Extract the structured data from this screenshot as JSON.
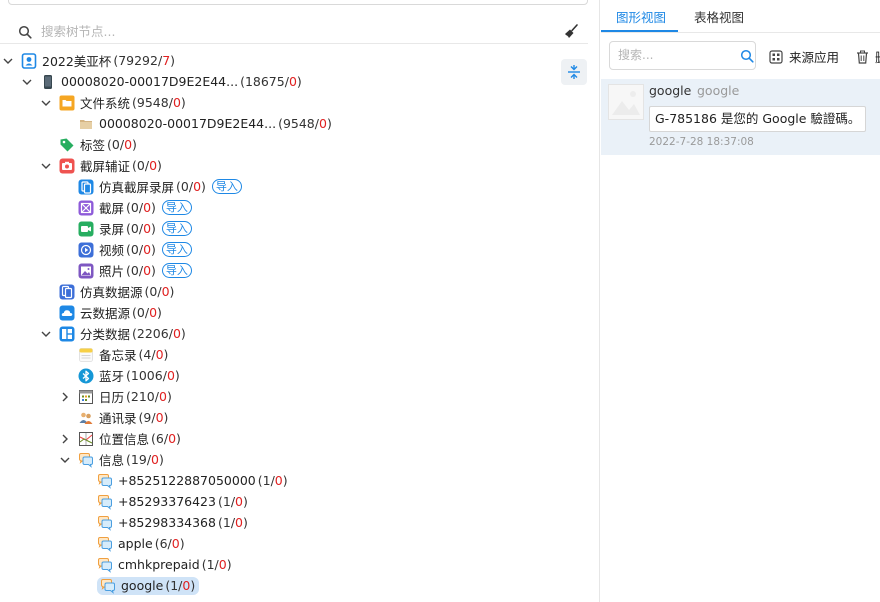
{
  "search": {
    "placeholder": "搜索树节点..."
  },
  "tree": [
    {
      "label": "2022美亚杯",
      "count": "79292",
      "red": "7",
      "level": 0,
      "chev": "down",
      "icon": "case-icon",
      "color": "#1e88e5"
    },
    {
      "label": "00008020-00017D9E2E44...",
      "count": "18675",
      "red": "0",
      "level": 1,
      "chev": "down",
      "icon": "phone-icon",
      "color": "#37474f"
    },
    {
      "label": "文件系统",
      "count": "9548",
      "red": "0",
      "level": 2,
      "chev": "down",
      "icon": "folder-icon",
      "color": "#f5a623"
    },
    {
      "label": "00008020-00017D9E2E44...",
      "count": "9548",
      "red": "0",
      "level": 3,
      "chev": "none",
      "icon": "archive-icon",
      "color": "#d4b483"
    },
    {
      "label": "标签",
      "count": "0",
      "red": "0",
      "level": 2,
      "chev": "none",
      "icon": "tag-icon",
      "color": "#27ae60"
    },
    {
      "label": "截屏辅证",
      "count": "0",
      "red": "0",
      "level": 2,
      "chev": "down",
      "icon": "camera-icon",
      "color": "#ef5350"
    },
    {
      "label": "仿真截屏录屏",
      "count": "0",
      "red": "0",
      "level": 3,
      "chev": "none",
      "icon": "emulate-icon",
      "color": "#1e88e5",
      "import": "导入"
    },
    {
      "label": "截屏",
      "count": "0",
      "red": "0",
      "level": 3,
      "chev": "none",
      "icon": "screenshot-icon",
      "color": "#8e5bd9",
      "import": "导入"
    },
    {
      "label": "录屏",
      "count": "0",
      "red": "0",
      "level": 3,
      "chev": "none",
      "icon": "record-icon",
      "color": "#27ae60",
      "import": "导入"
    },
    {
      "label": "视频",
      "count": "0",
      "red": "0",
      "level": 3,
      "chev": "none",
      "icon": "video-icon",
      "color": "#3d6fd8",
      "import": "导入"
    },
    {
      "label": "照片",
      "count": "0",
      "red": "0",
      "level": 3,
      "chev": "none",
      "icon": "photo-icon",
      "color": "#7e57c2",
      "import": "导入"
    },
    {
      "label": "仿真数据源",
      "count": "0",
      "red": "0",
      "level": 2,
      "chev": "none",
      "icon": "emulate-source-icon",
      "color": "#3d6fd8"
    },
    {
      "label": "云数据源",
      "count": "0",
      "red": "0",
      "level": 2,
      "chev": "none",
      "icon": "cloud-icon",
      "color": "#1e88e5"
    },
    {
      "label": "分类数据",
      "count": "2206",
      "red": "0",
      "level": 2,
      "chev": "down",
      "icon": "category-icon",
      "color": "#1e88e5"
    },
    {
      "label": "备忘录",
      "count": "4",
      "red": "0",
      "level": 3,
      "chev": "none",
      "icon": "notes-icon",
      "color": "#f7d046"
    },
    {
      "label": "蓝牙",
      "count": "1006",
      "red": "0",
      "level": 3,
      "chev": "none",
      "icon": "bluetooth-icon",
      "color": "#1597d6"
    },
    {
      "label": "日历",
      "count": "210",
      "red": "0",
      "level": 3,
      "chev": "right",
      "icon": "calendar-icon",
      "color": "#6b8e23"
    },
    {
      "label": "通讯录",
      "count": "9",
      "red": "0",
      "level": 3,
      "chev": "none",
      "icon": "contacts-icon",
      "color": "#5b7fa6"
    },
    {
      "label": "位置信息",
      "count": "6",
      "red": "0",
      "level": 3,
      "chev": "right",
      "icon": "location-icon",
      "color": "#6b8e23"
    },
    {
      "label": "信息",
      "count": "19",
      "red": "0",
      "level": 3,
      "chev": "down",
      "icon": "message-icon",
      "color": "#f0a040"
    },
    {
      "label": "+8525122887050000",
      "count": "1",
      "red": "0",
      "level": 4,
      "chev": "none",
      "icon": "chat-icon",
      "color": "#f0a040"
    },
    {
      "label": "+85293376423",
      "count": "1",
      "red": "0",
      "level": 4,
      "chev": "none",
      "icon": "chat-icon",
      "color": "#f0a040"
    },
    {
      "label": "+85298334368",
      "count": "1",
      "red": "0",
      "level": 4,
      "chev": "none",
      "icon": "chat-icon",
      "color": "#f0a040"
    },
    {
      "label": "apple",
      "count": "6",
      "red": "0",
      "level": 4,
      "chev": "none",
      "icon": "chat-icon",
      "color": "#f0a040"
    },
    {
      "label": "cmhkprepaid",
      "count": "1",
      "red": "0",
      "level": 4,
      "chev": "none",
      "icon": "chat-icon",
      "color": "#f0a040"
    },
    {
      "label": "google",
      "count": "1",
      "red": "0",
      "level": 4,
      "chev": "none",
      "icon": "chat-icon",
      "color": "#f0a040",
      "selected": true
    }
  ],
  "right": {
    "tabs": [
      "图形视图",
      "表格视图"
    ],
    "search_placeholder": "搜索...",
    "source_app": "来源应用",
    "delete": "删",
    "message": {
      "sender": "google",
      "sender_alias": "google",
      "text": "G-785186 是您的 Google 驗證碼。",
      "time": "2022-7-28 18:37:08"
    }
  }
}
